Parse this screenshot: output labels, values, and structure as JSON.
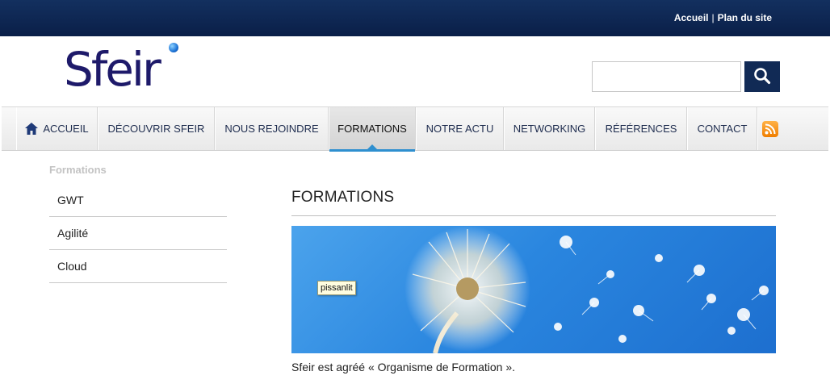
{
  "toplinks": {
    "home": "Accueil",
    "separator": "|",
    "sitemap": "Plan du site"
  },
  "logo": {
    "text": "Sfeir"
  },
  "search": {
    "value": "",
    "placeholder": "",
    "icon": "search-icon"
  },
  "nav": {
    "items": [
      {
        "label": "ACCUEIL",
        "icon": "home-icon"
      },
      {
        "label": "DÉCOUVRIR SFEIR"
      },
      {
        "label": "NOUS REJOINDRE"
      },
      {
        "label": "FORMATIONS",
        "active": true
      },
      {
        "label": "NOTRE ACTU"
      },
      {
        "label": "NETWORKING"
      },
      {
        "label": "RÉFÉRENCES"
      },
      {
        "label": "CONTACT"
      }
    ],
    "rss_icon": "rss-icon",
    "active_color": "#2e8fcf"
  },
  "sidebar": {
    "title": "Formations",
    "items": [
      {
        "label": "GWT"
      },
      {
        "label": "Agilité"
      },
      {
        "label": "Cloud"
      }
    ]
  },
  "main": {
    "title": "FORMATIONS",
    "banner_tooltip": "pissanlit",
    "caption": "Sfeir est agréé « Organisme de Formation »."
  },
  "colors": {
    "topbar": "#0a1f48",
    "logo": "#1e1a6a",
    "search_button": "#112a55"
  }
}
